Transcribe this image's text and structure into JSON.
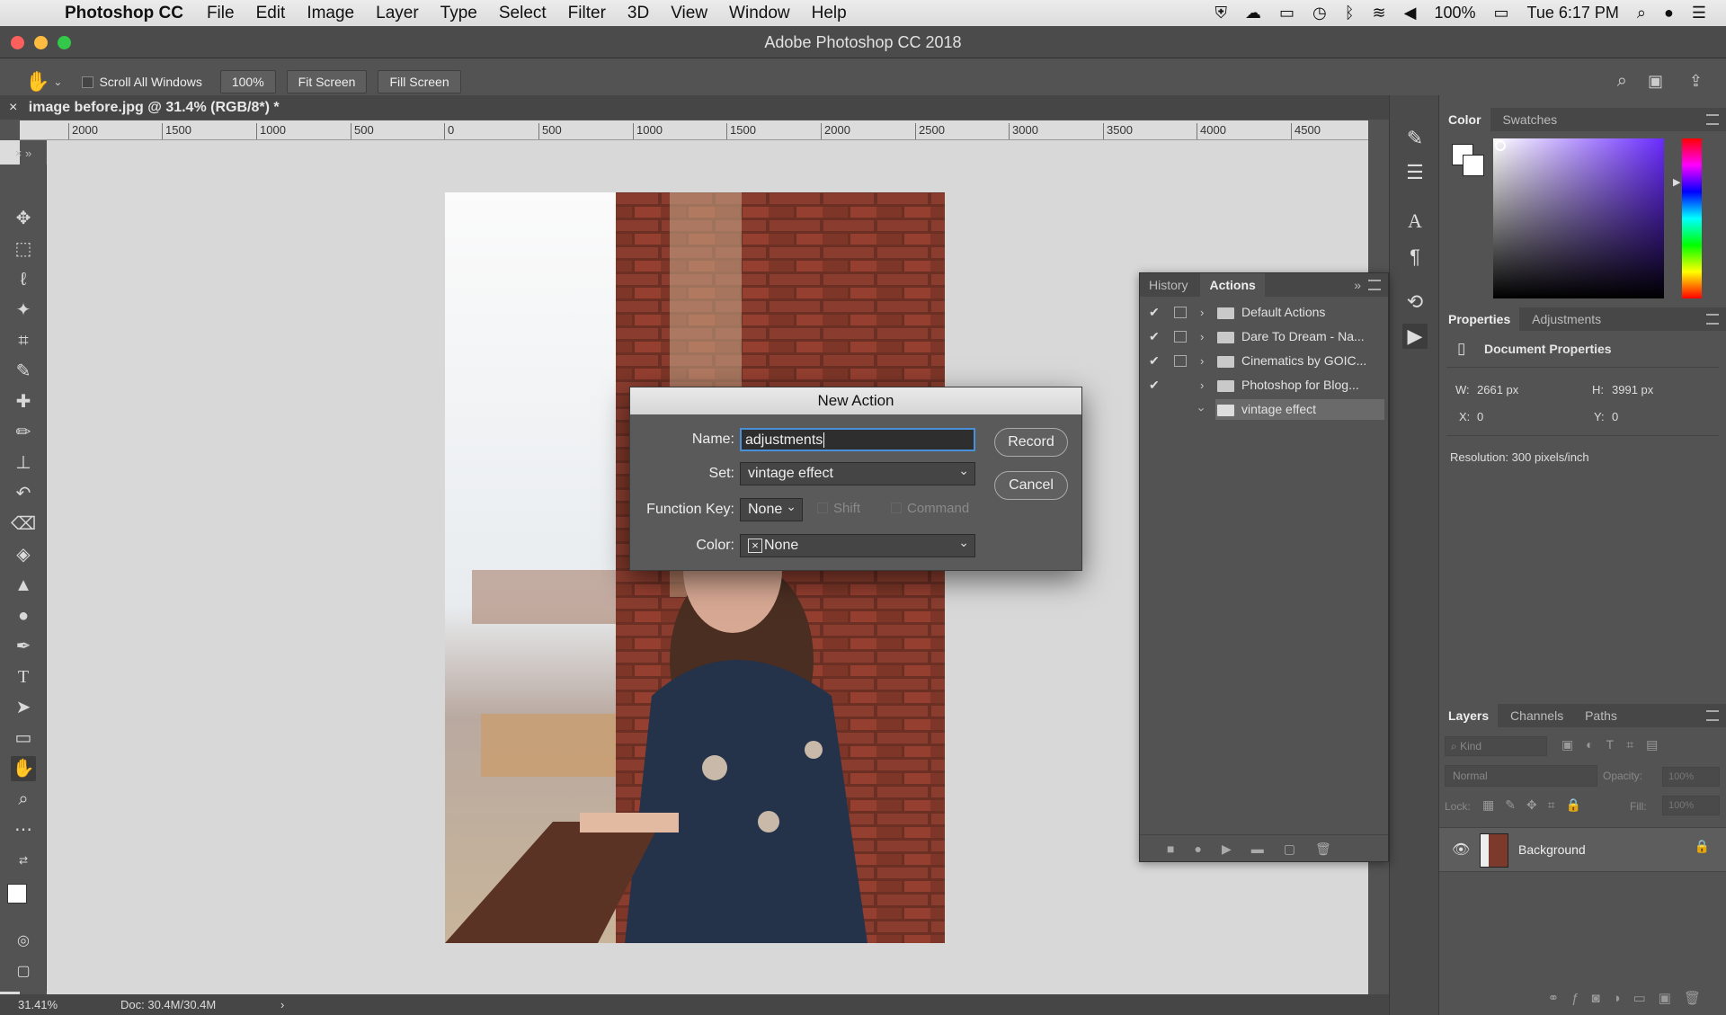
{
  "menubar": {
    "app_name": "Photoshop CC",
    "menus": [
      "File",
      "Edit",
      "Image",
      "Layer",
      "Type",
      "Select",
      "Filter",
      "3D",
      "View",
      "Window",
      "Help"
    ],
    "battery": "100%",
    "clock": "Tue 6:17 PM"
  },
  "window": {
    "title": "Adobe Photoshop CC 2018"
  },
  "options_bar": {
    "scroll_all_windows": "Scroll All Windows",
    "zoom": "100%",
    "fit_screen": "Fit Screen",
    "fill_screen": "Fill Screen"
  },
  "document": {
    "tab_title": "image before.jpg @ 31.4% (RGB/8*) *",
    "ruler_ticks": [
      "2000",
      "1500",
      "1000",
      "500",
      "0",
      "500",
      "1000",
      "1500",
      "2000",
      "2500",
      "3000",
      "3500",
      "4000",
      "4500"
    ]
  },
  "status_bar": {
    "zoom": "31.41%",
    "doc_size": "Doc: 30.4M/30.4M"
  },
  "history_panel": {
    "tabs": [
      "History",
      "Actions"
    ],
    "actions": [
      {
        "label": "Default Actions",
        "checked": true,
        "expanded": false
      },
      {
        "label": "Dare To Dream - Na...",
        "checked": true,
        "expanded": false
      },
      {
        "label": "Cinematics by GOIC...",
        "checked": true,
        "expanded": false
      },
      {
        "label": "Photoshop for Blog...",
        "checked": true,
        "expanded": false
      },
      {
        "label": "vintage effect",
        "checked": false,
        "expanded": true
      }
    ]
  },
  "new_action_dialog": {
    "title": "New Action",
    "name_label": "Name:",
    "name_value": "adjustments",
    "set_label": "Set:",
    "set_value": "vintage effect",
    "function_key_label": "Function Key:",
    "function_key_value": "None",
    "shift_label": "Shift",
    "command_label": "Command",
    "color_label": "Color:",
    "color_value": "None",
    "record_button": "Record",
    "cancel_button": "Cancel"
  },
  "color_panel": {
    "tabs": [
      "Color",
      "Swatches"
    ]
  },
  "properties_panel": {
    "tabs": [
      "Properties",
      "Adjustments"
    ],
    "header": "Document Properties",
    "w_label": "W:",
    "w_value": "2661 px",
    "h_label": "H:",
    "h_value": "3991 px",
    "x_label": "X:",
    "x_value": "0",
    "y_label": "Y:",
    "y_value": "0",
    "resolution": "Resolution: 300 pixels/inch"
  },
  "layers_panel": {
    "tabs": [
      "Layers",
      "Channels",
      "Paths"
    ],
    "filter_placeholder": "Kind",
    "blend_mode": "Normal",
    "opacity_label": "Opacity:",
    "opacity_value": "100%",
    "lock_label": "Lock:",
    "fill_label": "Fill:",
    "fill_value": "100%",
    "layers": [
      {
        "name": "Background"
      }
    ]
  },
  "colors": {
    "panel_bg": "#535353",
    "dialog_bg": "#5a5a5a",
    "selection": "#6a6a6a"
  }
}
